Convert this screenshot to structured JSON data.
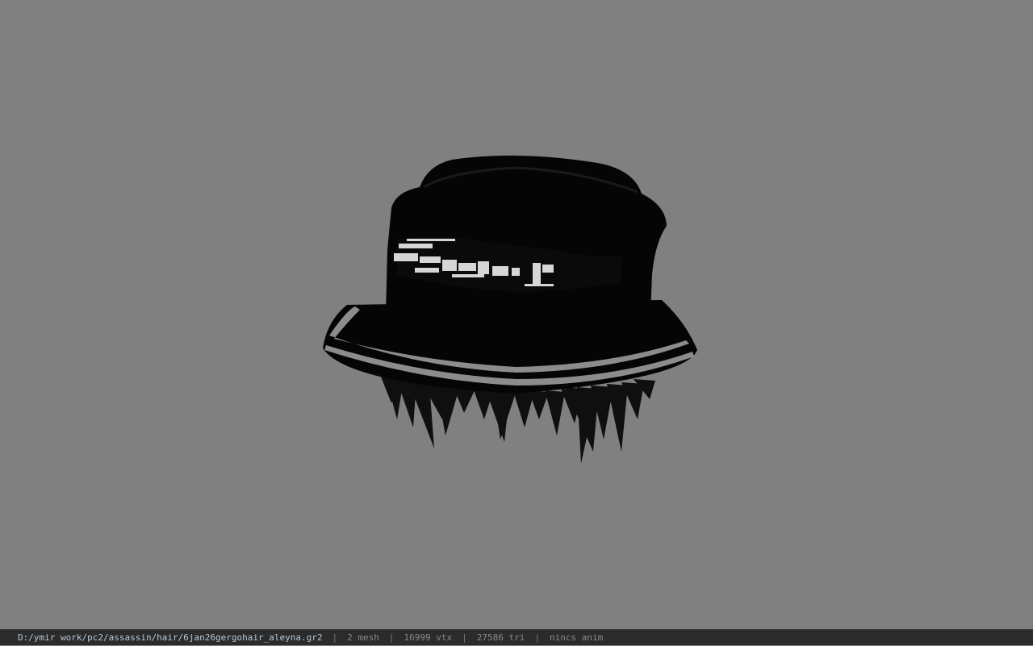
{
  "viewer": {
    "background_color": "#808080",
    "model": {
      "name": "hair-with-bucket-hat",
      "hat_color": "#050505",
      "stripe_color": "#8c8c8c",
      "band_texture_color": "#e8e8e8",
      "hair_color": "#0f0f0f"
    }
  },
  "statusbar": {
    "file_path": "D:/ymir work/pc2/assassin/hair/6jan26gergohair_aleyna.gr2",
    "separator": "|",
    "mesh_count": "2 mesh",
    "vertex_count": "16999 vtx",
    "triangle_count": "27586 tri",
    "anim_status": "nincs anim"
  }
}
